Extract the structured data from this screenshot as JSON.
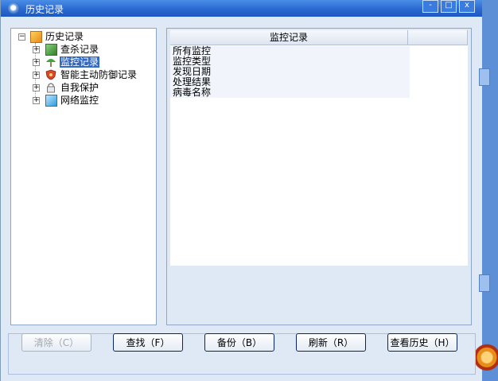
{
  "window": {
    "title": "历史记录"
  },
  "titlebar_buttons": {
    "minimize": "-",
    "maximize": "□",
    "close": "x"
  },
  "tree": {
    "root": {
      "label": "历史记录",
      "expander": "−"
    },
    "items": [
      {
        "label": "查杀记录",
        "expander": "+",
        "icon": "scan-log-icon",
        "selected": false
      },
      {
        "label": "监控记录",
        "expander": "+",
        "icon": "umbrella-icon",
        "selected": true
      },
      {
        "label": "智能主动防御记录",
        "expander": "+",
        "icon": "shield-icon",
        "selected": false
      },
      {
        "label": "自我保护",
        "expander": "+",
        "icon": "lock-icon",
        "selected": false
      },
      {
        "label": "网络监控",
        "expander": "+",
        "icon": "network-icon",
        "selected": false
      }
    ]
  },
  "list": {
    "header": "监控记录",
    "rows": [
      "所有监控",
      "监控类型",
      "发现日期",
      "处理结果",
      "病毒名称"
    ]
  },
  "buttons": {
    "clear": "清除（C）",
    "find": "查找（F）",
    "backup": "备份（B）",
    "refresh": "刷新（R）",
    "view_history": "查看历史（H）"
  }
}
